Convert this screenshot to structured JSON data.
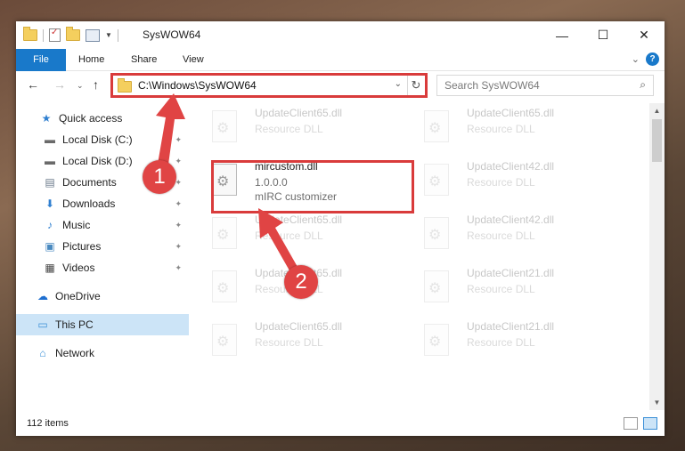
{
  "window": {
    "title": "SysWOW64",
    "minimize": "—",
    "maximize": "☐",
    "close": "✕"
  },
  "ribbon": {
    "tabs": [
      "File",
      "Home",
      "Share",
      "View"
    ],
    "expand_icon": "⌄",
    "help": "?"
  },
  "nav": {
    "back": "←",
    "forward": "→",
    "recent": "⌄",
    "up": "↑"
  },
  "address": {
    "path": "C:\\Windows\\SysWOW64",
    "dropdown": "⌄",
    "refresh": "↻"
  },
  "search": {
    "placeholder": "Search SysWOW64",
    "icon": "⌕"
  },
  "sidebar": {
    "items": [
      {
        "label": "Quick access",
        "icon": "★",
        "icon_color": "#2f7fd0"
      },
      {
        "label": "Local Disk (C:)",
        "icon": "▬",
        "icon_color": "#6a6a6a",
        "pinned": "📌"
      },
      {
        "label": "Local Disk (D:)",
        "icon": "▬",
        "icon_color": "#6a6a6a",
        "pinned": "📌"
      },
      {
        "label": "Documents",
        "icon": "▤",
        "icon_color": "#6a7a8a",
        "pinned": "📌"
      },
      {
        "label": "Downloads",
        "icon": "⬇",
        "icon_color": "#2f7fd0",
        "pinned": "📌"
      },
      {
        "label": "Music",
        "icon": "♪",
        "icon_color": "#2f7fd0",
        "pinned": "📌"
      },
      {
        "label": "Pictures",
        "icon": "▣",
        "icon_color": "#4a8ac0",
        "pinned": "📌"
      },
      {
        "label": "Videos",
        "icon": "▦",
        "icon_color": "#444",
        "pinned": "📌"
      },
      {
        "label": "OneDrive",
        "icon": "☁",
        "icon_color": "#1e6fd0"
      },
      {
        "label": "This PC",
        "icon": "▭",
        "icon_color": "#3a8fd7"
      },
      {
        "label": "Network",
        "icon": "⌂",
        "icon_color": "#3a8fd7"
      }
    ]
  },
  "files": {
    "left": [
      {
        "name": "UpdateClient65.dll",
        "type": "Resource DLL"
      },
      {
        "name": "mircustom.dll",
        "version": "1.0.0.0",
        "type": "mIRC customizer"
      },
      {
        "name": "UpdateClient65.dll",
        "type": "Resource DLL"
      },
      {
        "name": "UpdateClient65.dll",
        "type": "Resource DLL"
      },
      {
        "name": "UpdateClient65.dll",
        "type": "Resource DLL"
      }
    ],
    "right": [
      {
        "name": "UpdateClient65.dll",
        "type": "Resource DLL"
      },
      {
        "name": "UpdateClient42.dll",
        "type": "Resource DLL"
      },
      {
        "name": "UpdateClient42.dll",
        "type": "Resource DLL"
      },
      {
        "name": "UpdateClient21.dll",
        "type": "Resource DLL"
      },
      {
        "name": "UpdateClient21.dll",
        "type": "Resource DLL"
      }
    ]
  },
  "scrollbar": {
    "up": "▲",
    "down": "▼"
  },
  "status": {
    "items_count": "112 items"
  },
  "annotations": {
    "step1": "1",
    "step2": "2",
    "color": "#d93b3b"
  }
}
